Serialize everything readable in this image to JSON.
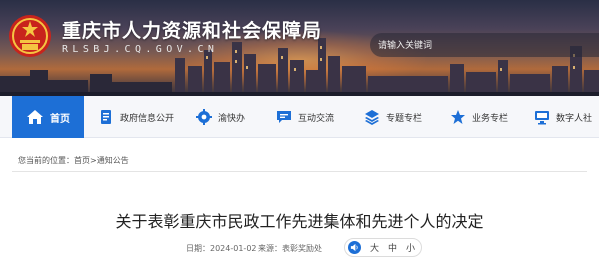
{
  "header": {
    "title": "重庆市人力资源和社会保障局",
    "domain": "RLSBJ.CQ.GOV.CN",
    "logo_icon": "government-emblem-icon",
    "search": {
      "placeholder": "请输入关键词",
      "value": ""
    }
  },
  "nav": {
    "items": [
      {
        "label": "首页",
        "icon": "home-icon"
      },
      {
        "label": "政府信息公开",
        "icon": "document-icon"
      },
      {
        "label": "渝快办",
        "icon": "gear-icon"
      },
      {
        "label": "互动交流",
        "icon": "chat-icon"
      },
      {
        "label": "专题专栏",
        "icon": "layers-icon"
      },
      {
        "label": "业务专栏",
        "icon": "star-icon"
      },
      {
        "label": "数字人社",
        "icon": "computer-icon"
      }
    ],
    "active_color": "#1d6fd6"
  },
  "breadcrumb": {
    "prefix": "您当前的位置：",
    "items": [
      "首页",
      "通知公告"
    ],
    "separator": ">"
  },
  "article": {
    "title": "关于表彰重庆市民政工作先进集体和先进个人的决定",
    "date_label": "日期：",
    "date": "2024-01-02",
    "source_label": "来源：",
    "source": "表彰奖励处",
    "font_sizes": [
      "大",
      "中",
      "小"
    ],
    "speaker_icon": "speaker-icon"
  }
}
